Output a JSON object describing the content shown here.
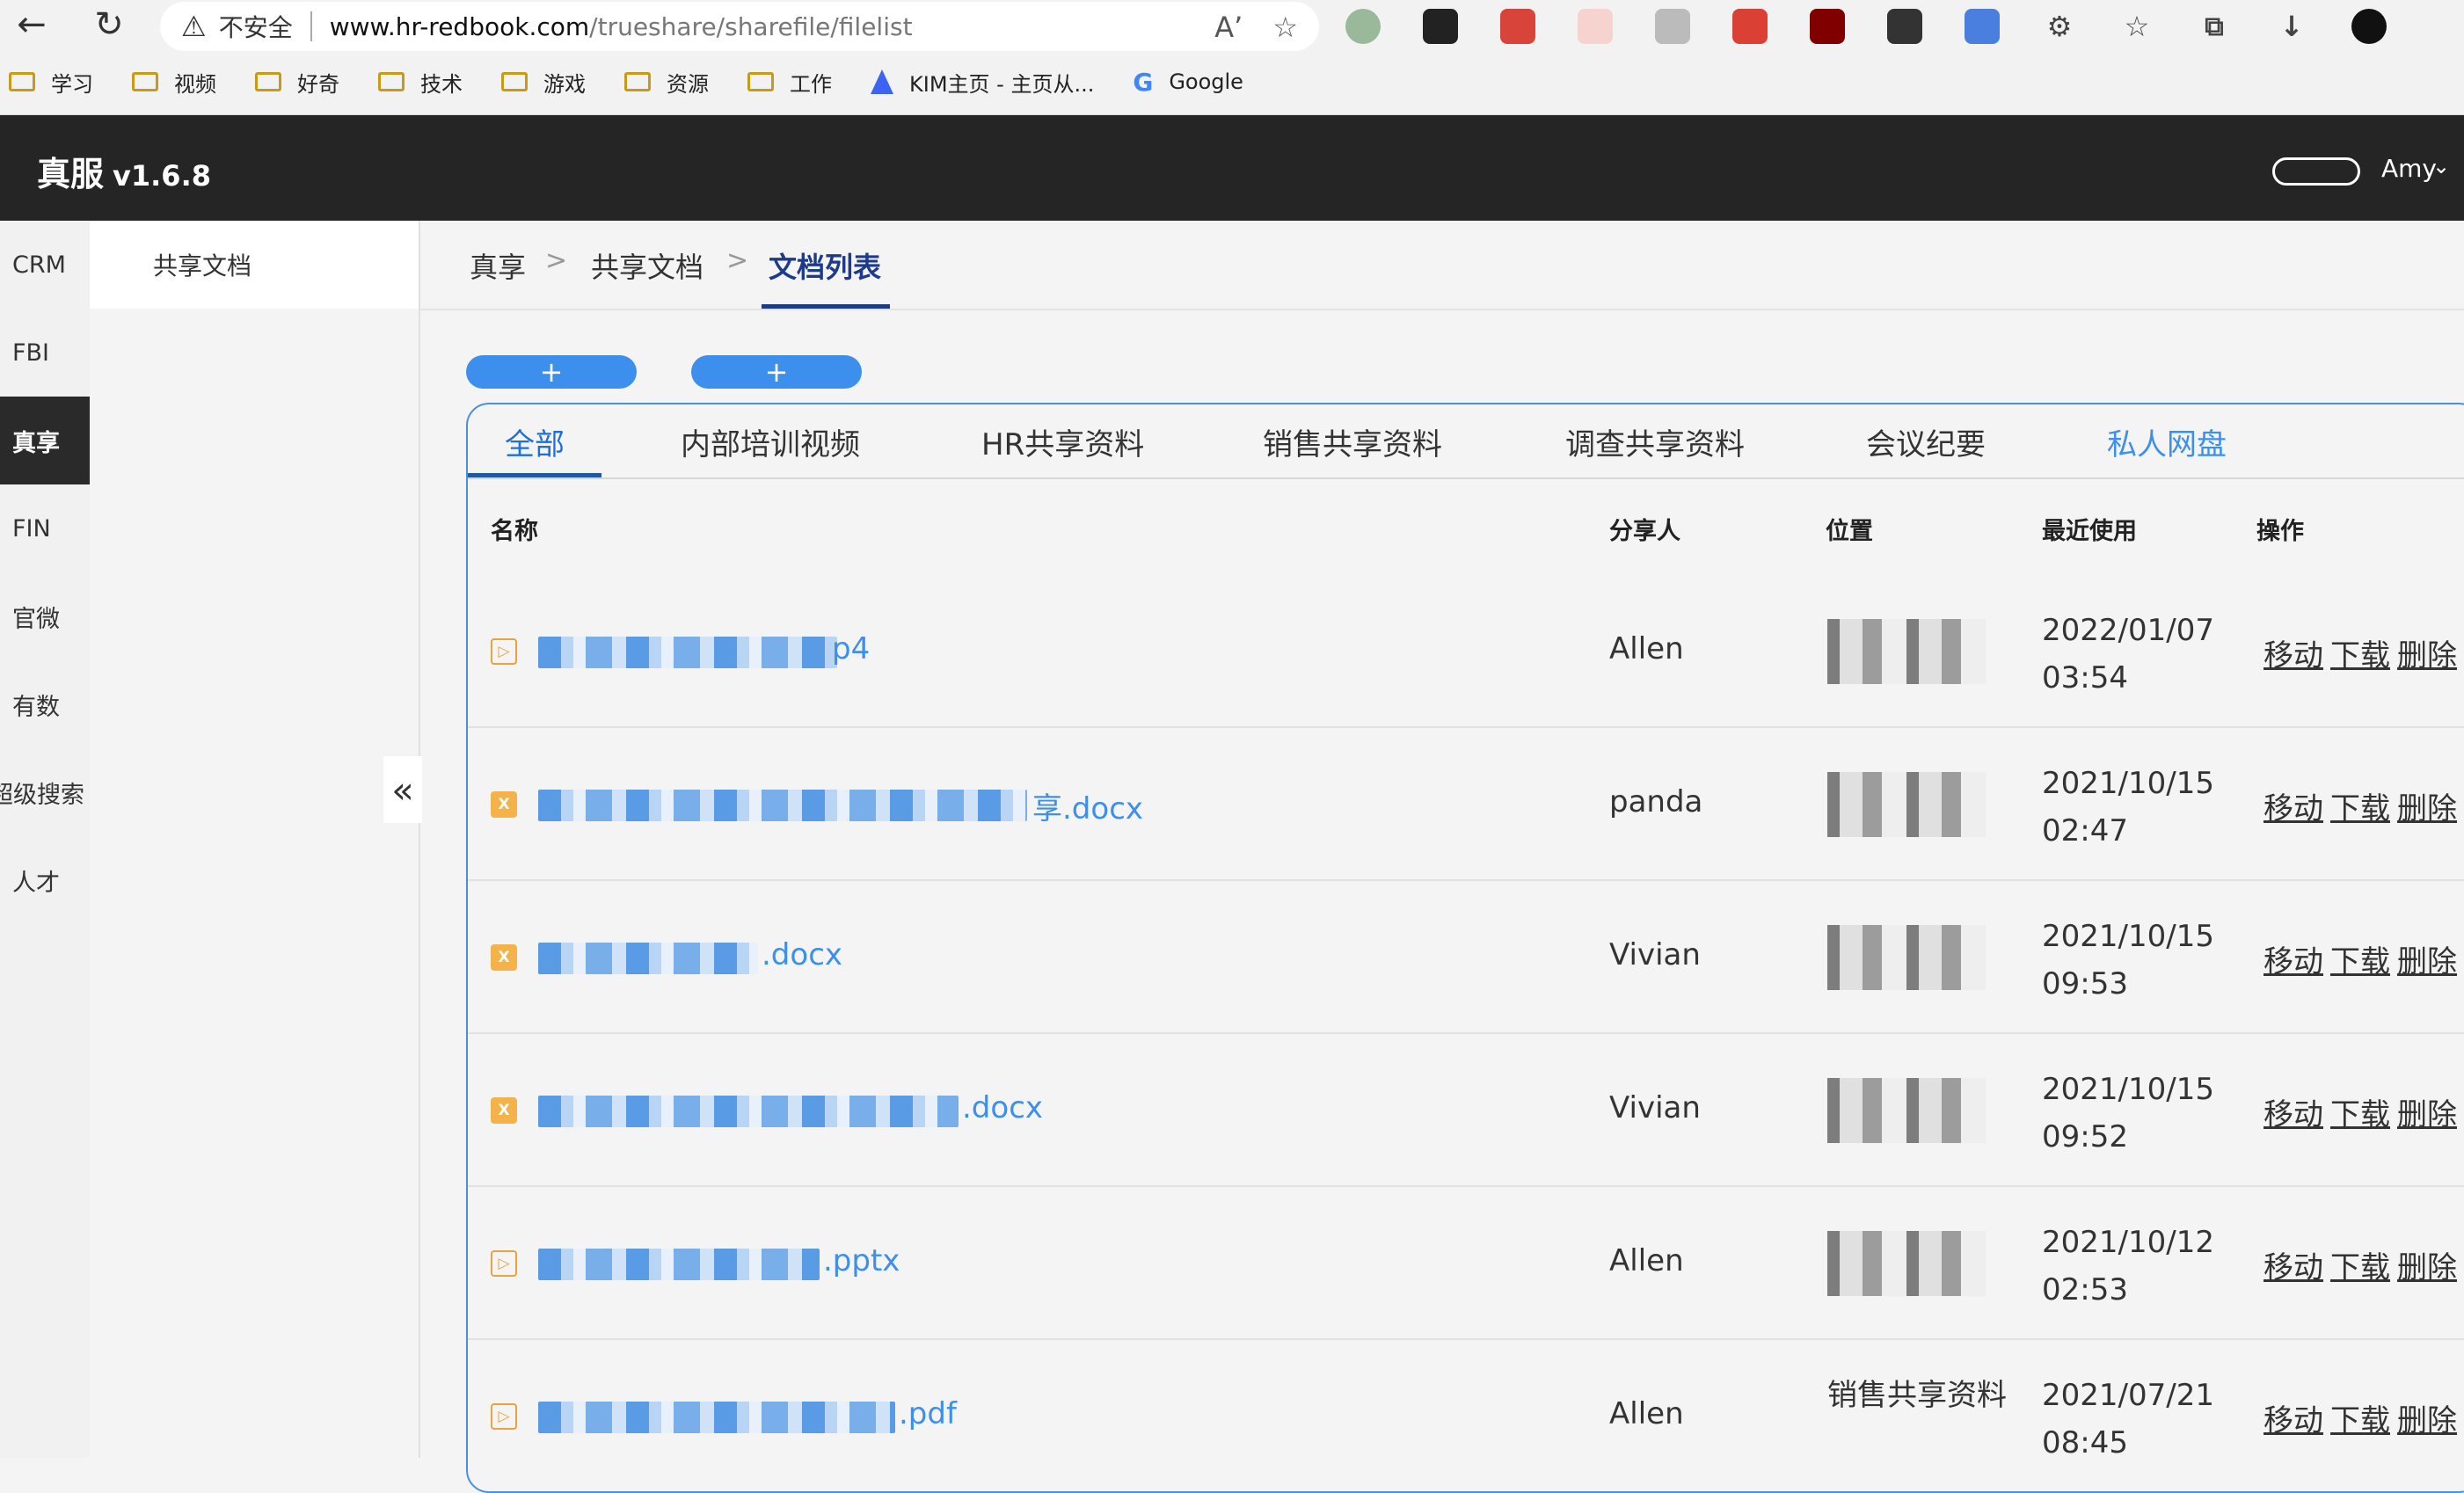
{
  "browser": {
    "not_secure": "不安全",
    "url_host": "www.hr-redbook.com",
    "url_path": "/trueshare/sharefile/filelist",
    "read_aloud_glyph": "Aʼ",
    "bookmarks": [
      "学习",
      "视频",
      "好奇",
      "技术",
      "游戏",
      "资源",
      "工作",
      "KIM主页 - 主页从...",
      "Google"
    ]
  },
  "header": {
    "app_name": "真服",
    "version": "v1.6.8",
    "user": "Amy"
  },
  "rail": {
    "items": [
      "CRM",
      "FBI",
      "真享",
      "FIN",
      "官微",
      "有数",
      "超级搜索",
      "人才"
    ],
    "active": "真享"
  },
  "sub_sidebar": {
    "item": "共享文档"
  },
  "breadcrumb": {
    "c1": "真享",
    "c2": "共享文档",
    "c3": "文档列表",
    "sep": ">"
  },
  "actions": {
    "icon": "+"
  },
  "tabs": [
    "全部",
    "内部培训视频",
    "HR共享资料",
    "销售共享资料",
    "调查共享资料",
    "会议纪要",
    "私人网盘"
  ],
  "table": {
    "headers": {
      "name": "名称",
      "sharer": "分享人",
      "location": "位置",
      "last_used": "最近使用",
      "ops": "操作"
    },
    "op_labels": {
      "move": "移动",
      "download": "下载",
      "delete": "删除"
    },
    "rows": [
      {
        "icon": "video",
        "ext": "p4",
        "sharer": "Allen",
        "date": "2022/01/07",
        "time": "03:54",
        "location": ""
      },
      {
        "icon": "word",
        "ext": "享.docx",
        "sharer": "panda",
        "date": "2021/10/15",
        "time": "02:47",
        "location": ""
      },
      {
        "icon": "word",
        "ext": ".docx",
        "sharer": "Vivian",
        "date": "2021/10/15",
        "time": "09:53",
        "location": ""
      },
      {
        "icon": "word",
        "ext": ".docx",
        "sharer": "Vivian",
        "date": "2021/10/15",
        "time": "09:52",
        "location": ""
      },
      {
        "icon": "video",
        "ext": ".pptx",
        "sharer": "Allen",
        "date": "2021/10/12",
        "time": "02:53",
        "location": ""
      },
      {
        "icon": "video",
        "ext": ".pdf",
        "sharer": "Allen",
        "date": "2021/07/21",
        "time": "08:45",
        "location": "销售共享资料"
      }
    ]
  },
  "colors": {
    "accent": "#3d8fee",
    "header_bg": "#252525",
    "active_tab": "#1e6fd9"
  }
}
